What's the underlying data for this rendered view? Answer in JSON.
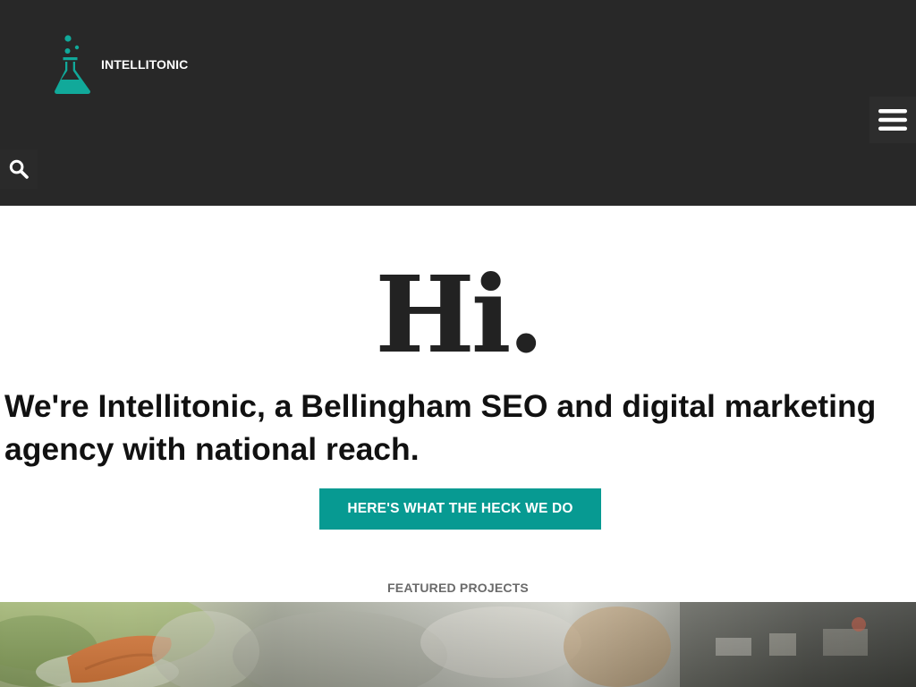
{
  "brand": {
    "name": "INTELLITONIC"
  },
  "colors": {
    "header_bg": "#282828",
    "accent": "#079a92",
    "logo_teal": "#11a99a"
  },
  "icons": {
    "logo": "flask-icon",
    "menu": "hamburger-menu-icon",
    "search": "search-icon"
  },
  "hero": {
    "greeting": "Hi.",
    "tagline": "We're Intellitonic, a Bellingham SEO and digital marketing agency with national reach.",
    "cta_label": "HERE'S WHAT THE HECK WE DO"
  },
  "featured": {
    "heading": "FEATURED PROJECTS"
  }
}
